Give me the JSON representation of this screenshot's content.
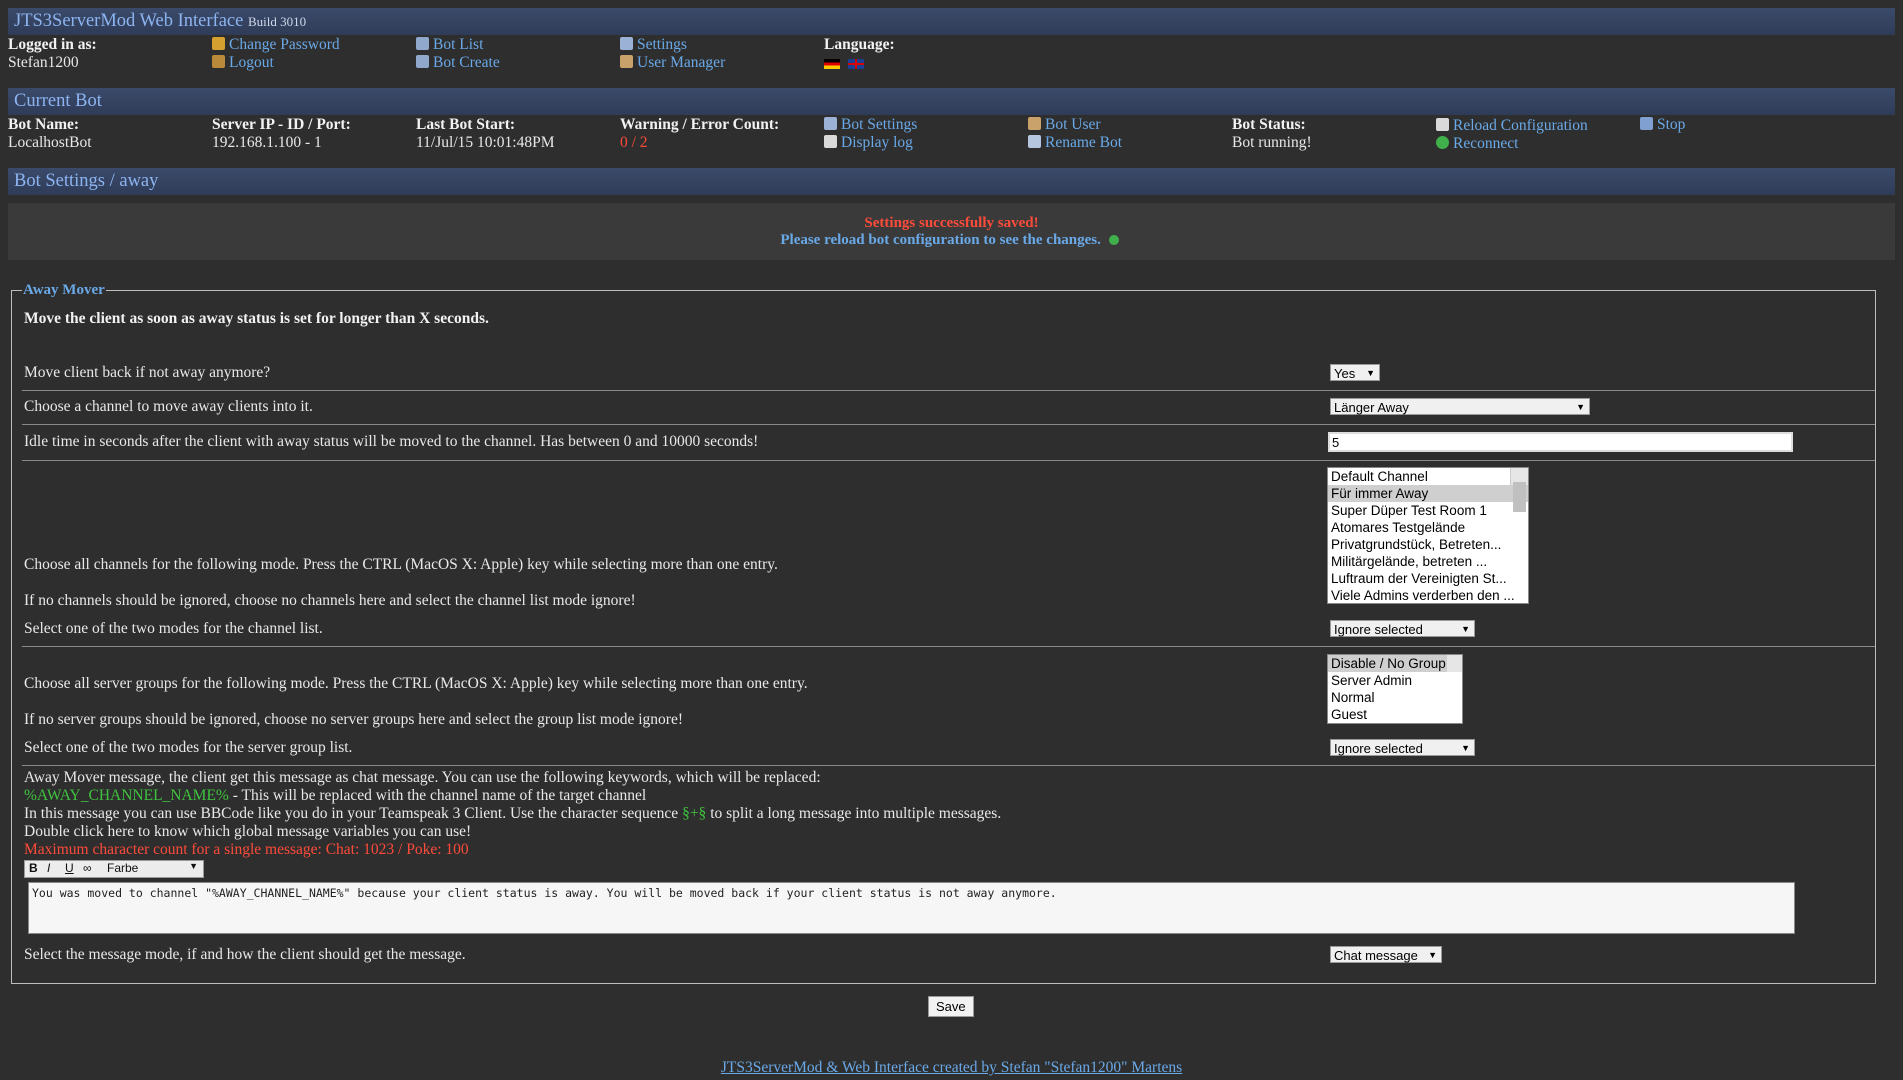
{
  "header": {
    "title": "JTS3ServerMod Web Interface",
    "build": "Build 3010"
  },
  "login": {
    "label": "Logged in as:",
    "user": "Stefan1200"
  },
  "nav": {
    "change_password": "Change Password",
    "logout": "Logout",
    "bot_list": "Bot List",
    "bot_create": "Bot Create",
    "settings": "Settings",
    "user_manager": "User Manager",
    "language_label": "Language:"
  },
  "current_bot": {
    "title": "Current Bot",
    "bot_name_label": "Bot Name:",
    "bot_name": "LocalhostBot",
    "server_label": "Server IP - ID / Port:",
    "server": "192.168.1.100 - 1",
    "last_start_label": "Last Bot Start:",
    "last_start": "11/Jul/15 10:01:48PM",
    "warning_label": "Warning / Error Count:",
    "warning": "0 / 2",
    "bot_settings": "Bot Settings",
    "display_log": "Display log",
    "bot_user": "Bot User",
    "rename_bot": "Rename Bot",
    "status_label": "Bot Status:",
    "status": "Bot running!",
    "reload_config": "Reload Configuration",
    "reconnect": "Reconnect",
    "stop": "Stop"
  },
  "section": {
    "title": "Bot Settings / away"
  },
  "notice": {
    "saved": "Settings successfully saved!",
    "reload": "Please reload bot configuration to see the changes."
  },
  "away": {
    "legend": "Away Mover",
    "description": "Move the client as soon as away status is set for longer than X seconds.",
    "move_back_label": "Move client back if not away anymore?",
    "move_back_value": "Yes",
    "channel_label": "Choose a channel to move away clients into it.",
    "channel_value": "Länger Away",
    "idle_label": "Idle time in seconds after the client with away status will be moved to the channel. Has between 0 and 10000 seconds!",
    "idle_value": "5",
    "channels_help1": "Choose all channels for the following mode. Press the CTRL (MacOS X: Apple) key while selecting more than one entry.",
    "channels_help2": "If no channels should be ignored, choose no channels here and select the channel list mode ignore!",
    "channels": [
      "Default Channel",
      "Für immer Away",
      "Super Düper Test Room 1",
      "Atomares Testgelände",
      "Privatgrundstück, Betreten...",
      "Militärgelände, betreten ...",
      "Luftraum der Vereinigten St...",
      "Viele Admins verderben den ..."
    ],
    "channel_mode_label": "Select one of the two modes for the channel list.",
    "channel_mode_value": "Ignore selected",
    "groups_help1": "Choose all server groups for the following mode. Press the CTRL (MacOS X: Apple) key while selecting more than one entry.",
    "groups_help2": "If no server groups should be ignored, choose no server groups here and select the group list mode ignore!",
    "groups": [
      "Disable / No Group",
      "Server Admin",
      "Normal",
      "Guest"
    ],
    "group_mode_label": "Select one of the two modes for the server group list.",
    "group_mode_value": "Ignore selected",
    "msg_line1": "Away Mover message, the client get this message as chat message. You can use the following keywords, which will be replaced:",
    "msg_keyword": "%AWAY_CHANNEL_NAME%",
    "msg_keyword_desc": " - This will be replaced with the channel name of the target channel",
    "msg_line3a": "In this message you can use BBCode like you do in your Teamspeak 3 Client. Use the character sequence ",
    "msg_seq": "§+§",
    "msg_line3b": " to split a long message into multiple messages.",
    "msg_line4": "Double click here to know which global message variables you can use!",
    "msg_max": "Maximum character count for a single message: Chat: 1023 / Poke: 100",
    "color_label": "Farbe",
    "message": "You was moved to channel \"%AWAY_CHANNEL_NAME%\" because your client status is away. You will be moved back if your client status is not away anymore.",
    "msg_mode_label": "Select the message mode, if and how the client should get the message.",
    "msg_mode_value": "Chat message"
  },
  "save_label": "Save",
  "footer": "JTS3ServerMod & Web Interface created by Stefan \"Stefan1200\" Martens"
}
